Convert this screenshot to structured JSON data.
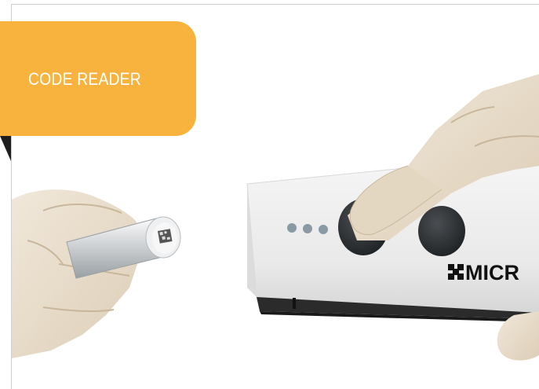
{
  "label": {
    "text": "CODE READER"
  },
  "device": {
    "brand_text": "MICR"
  },
  "colors": {
    "accent": "#f7b33d",
    "fold": "#1e1e1e",
    "device_body": "#ececec",
    "device_base": "#2b2b2b",
    "glove": "#e8dccb",
    "indicator_dots": "#8a9aa4"
  },
  "icons": [
    "micro-logo-icon",
    "indicator-dots-icon",
    "datamatrix-code-icon"
  ]
}
